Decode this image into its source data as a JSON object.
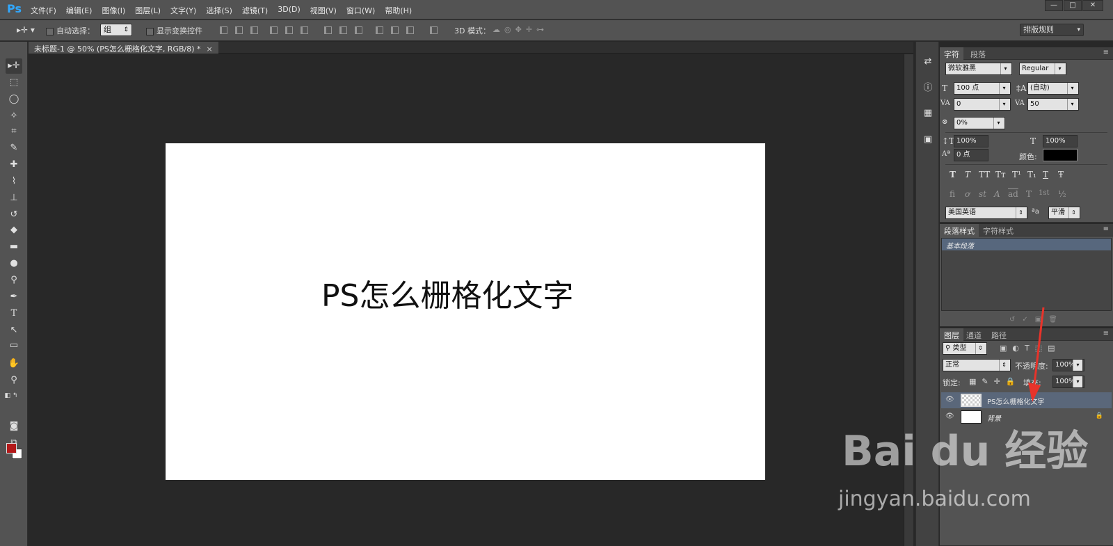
{
  "app": {
    "logo": "Ps"
  },
  "menu": [
    "文件(F)",
    "编辑(E)",
    "图像(I)",
    "图层(L)",
    "文字(Y)",
    "选择(S)",
    "滤镜(T)",
    "3D(D)",
    "视图(V)",
    "窗口(W)",
    "帮助(H)"
  ],
  "window_controls": {
    "minimize": "—",
    "restore": "□",
    "close": "✕"
  },
  "options": {
    "auto_select_label": "自动选择：",
    "auto_select_value": "组",
    "show_transform_label": "显示变换控件",
    "mode_3d_label": "3D 模式：",
    "workspace": "排版规则"
  },
  "document": {
    "tab_title": "未标题-1 @ 50% (PS怎么栅格化文字, RGB/8) *",
    "tab_close": "×",
    "canvas_text": "PS怎么栅格化文字"
  },
  "character_panel": {
    "tab_character": "字符",
    "tab_paragraph": "段落",
    "font_family": "微软雅黑",
    "font_style": "Regular",
    "font_size": "100 点",
    "leading": "(自动)",
    "kerning": "0",
    "tracking": "50",
    "tsume": "0%",
    "vertical_scale": "100%",
    "horizontal_scale": "100%",
    "baseline_shift": "0 点",
    "color_label": "颜色:",
    "style_buttons": [
      "T",
      "T",
      "TT",
      "Tт",
      "T¹",
      "T₁",
      "T",
      "Ŧ"
    ],
    "opentype_buttons": [
      "fi",
      "ơ",
      "st",
      "A",
      "ad",
      "T",
      "1st",
      "½"
    ],
    "language": "美国英语",
    "aa_label": "ªa",
    "antialias": "平滑"
  },
  "styles_panel": {
    "tab_paragraph_styles": "段落样式",
    "tab_character_styles": "字符样式",
    "items": [
      "基本段落"
    ]
  },
  "layers_panel": {
    "tab_layers": "图层",
    "tab_channels": "通道",
    "tab_paths": "路径",
    "filter_kind": "类型",
    "blend_mode": "正常",
    "opacity_label": "不透明度:",
    "opacity": "100%",
    "lock_label": "锁定:",
    "fill_label": "填充:",
    "fill": "100%",
    "layers": [
      {
        "name": "PS怎么栅格化文字",
        "selected": true
      },
      {
        "name": "背景",
        "selected": false
      }
    ]
  },
  "watermark": {
    "brand": "Bai du 经验",
    "url": "jingyan.baidu.com"
  },
  "colors": {
    "foreground": "#b3191a",
    "background": "#ffffff",
    "accent": "#31a8ff",
    "selection": "#5a677a",
    "annotation_arrow": "#e8332a"
  }
}
